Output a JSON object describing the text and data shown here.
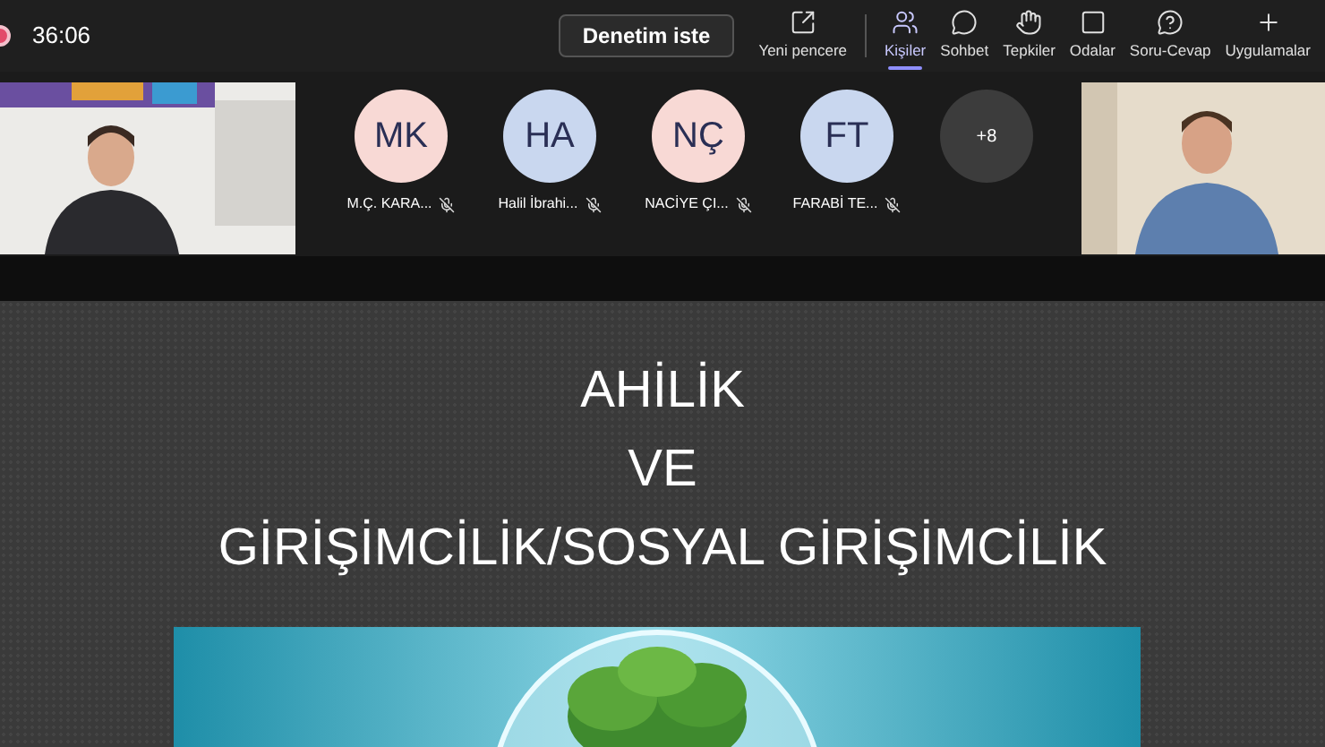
{
  "top_bar": {
    "recording": true,
    "timer": "36:06",
    "request_button": "Denetim iste",
    "actions": [
      {
        "label": "Yeni pencere",
        "selected": false
      },
      {
        "label": "Kişiler",
        "selected": true
      },
      {
        "label": "Sohbet",
        "selected": false
      },
      {
        "label": "Tepkiler",
        "selected": false
      },
      {
        "label": "Odalar",
        "selected": false
      },
      {
        "label": "Soru-Cevap",
        "selected": false
      },
      {
        "label": "Uygulamalar",
        "selected": false
      }
    ]
  },
  "participants": {
    "videos": [
      {
        "kind": "picture"
      },
      {
        "kind": "picture"
      }
    ],
    "avatars": [
      {
        "initials": "MK",
        "name": "M.Ç. KARA...",
        "muted": true,
        "color": "#f8d9d5"
      },
      {
        "initials": "HA",
        "name": "Halil İbrahi...",
        "muted": true,
        "color": "#c9d7ef"
      },
      {
        "initials": "NÇ",
        "name": "NACİYE ÇI...",
        "muted": true,
        "color": "#f8d9d5"
      },
      {
        "initials": "FT",
        "name": "FARABİ TE...",
        "muted": true,
        "color": "#c9d7ef"
      }
    ],
    "overflow": "+8"
  },
  "slide": {
    "lines": [
      "AHİLİK",
      "VE",
      "GİRİŞİMCİLİK/SOSYAL GİRİŞİMCİLİK"
    ],
    "image": {
      "kind": "picture"
    }
  }
}
